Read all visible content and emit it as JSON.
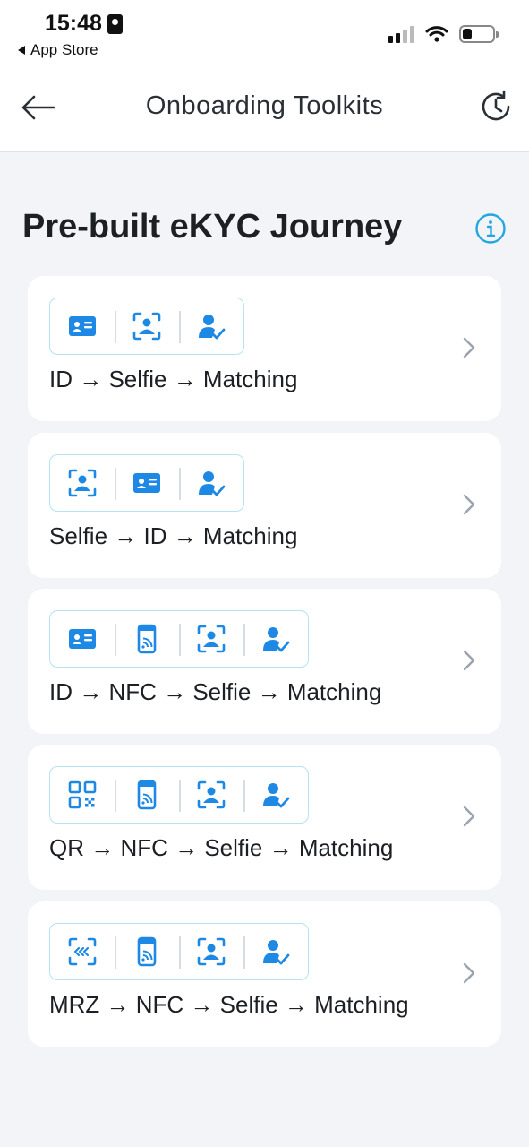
{
  "status_bar": {
    "time": "15:48",
    "back_app_label": "App Store"
  },
  "nav": {
    "title": "Onboarding Toolkits",
    "back_icon": "arrow-left-icon",
    "history_icon": "history-icon"
  },
  "section": {
    "title": "Pre-built eKYC Journey",
    "info_icon": "info-icon"
  },
  "colors": {
    "accent": "#1e88e5",
    "strip_border": "#b6e3f1",
    "background": "#f2f4f7",
    "card": "#ffffff"
  },
  "journeys": [
    {
      "label": "ID → Selfie → Matching",
      "icons": [
        "id-card-icon",
        "selfie-scan-icon",
        "user-check-icon"
      ]
    },
    {
      "label": "Selfie → ID → Matching",
      "icons": [
        "selfie-scan-icon",
        "id-card-icon",
        "user-check-icon"
      ]
    },
    {
      "label": "ID → NFC → Selfie → Matching",
      "icons": [
        "id-card-icon",
        "nfc-phone-icon",
        "selfie-scan-icon",
        "user-check-icon"
      ]
    },
    {
      "label": "QR → NFC → Selfie → Matching",
      "icons": [
        "qr-code-icon",
        "nfc-phone-icon",
        "selfie-scan-icon",
        "user-check-icon"
      ]
    },
    {
      "label": "MRZ → NFC → Selfie → Matching",
      "icons": [
        "mrz-scan-icon",
        "nfc-phone-icon",
        "selfie-scan-icon",
        "user-check-icon"
      ]
    }
  ]
}
